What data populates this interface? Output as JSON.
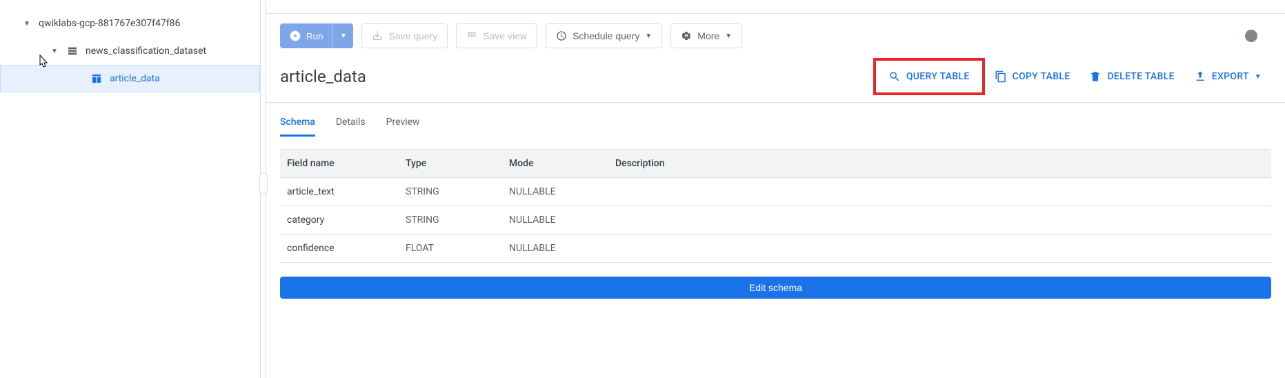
{
  "sidebar": {
    "project": "qwiklabs-gcp-881767e307f47f86",
    "dataset": "news_classification_dataset",
    "table": "article_data"
  },
  "toolbar": {
    "run": "Run",
    "save_query": "Save query",
    "save_view": "Save view",
    "schedule_query": "Schedule query",
    "more": "More"
  },
  "header": {
    "title": "article_data",
    "actions": {
      "query_table": "QUERY TABLE",
      "copy_table": "COPY TABLE",
      "delete_table": "DELETE TABLE",
      "export": "EXPORT"
    }
  },
  "tabs": {
    "schema": "Schema",
    "details": "Details",
    "preview": "Preview"
  },
  "schema": {
    "headers": {
      "field": "Field name",
      "type": "Type",
      "mode": "Mode",
      "desc": "Description"
    },
    "rows": [
      {
        "field": "article_text",
        "type": "STRING",
        "mode": "NULLABLE",
        "desc": ""
      },
      {
        "field": "category",
        "type": "STRING",
        "mode": "NULLABLE",
        "desc": ""
      },
      {
        "field": "confidence",
        "type": "FLOAT",
        "mode": "NULLABLE",
        "desc": ""
      }
    ],
    "edit_button": "Edit schema"
  }
}
